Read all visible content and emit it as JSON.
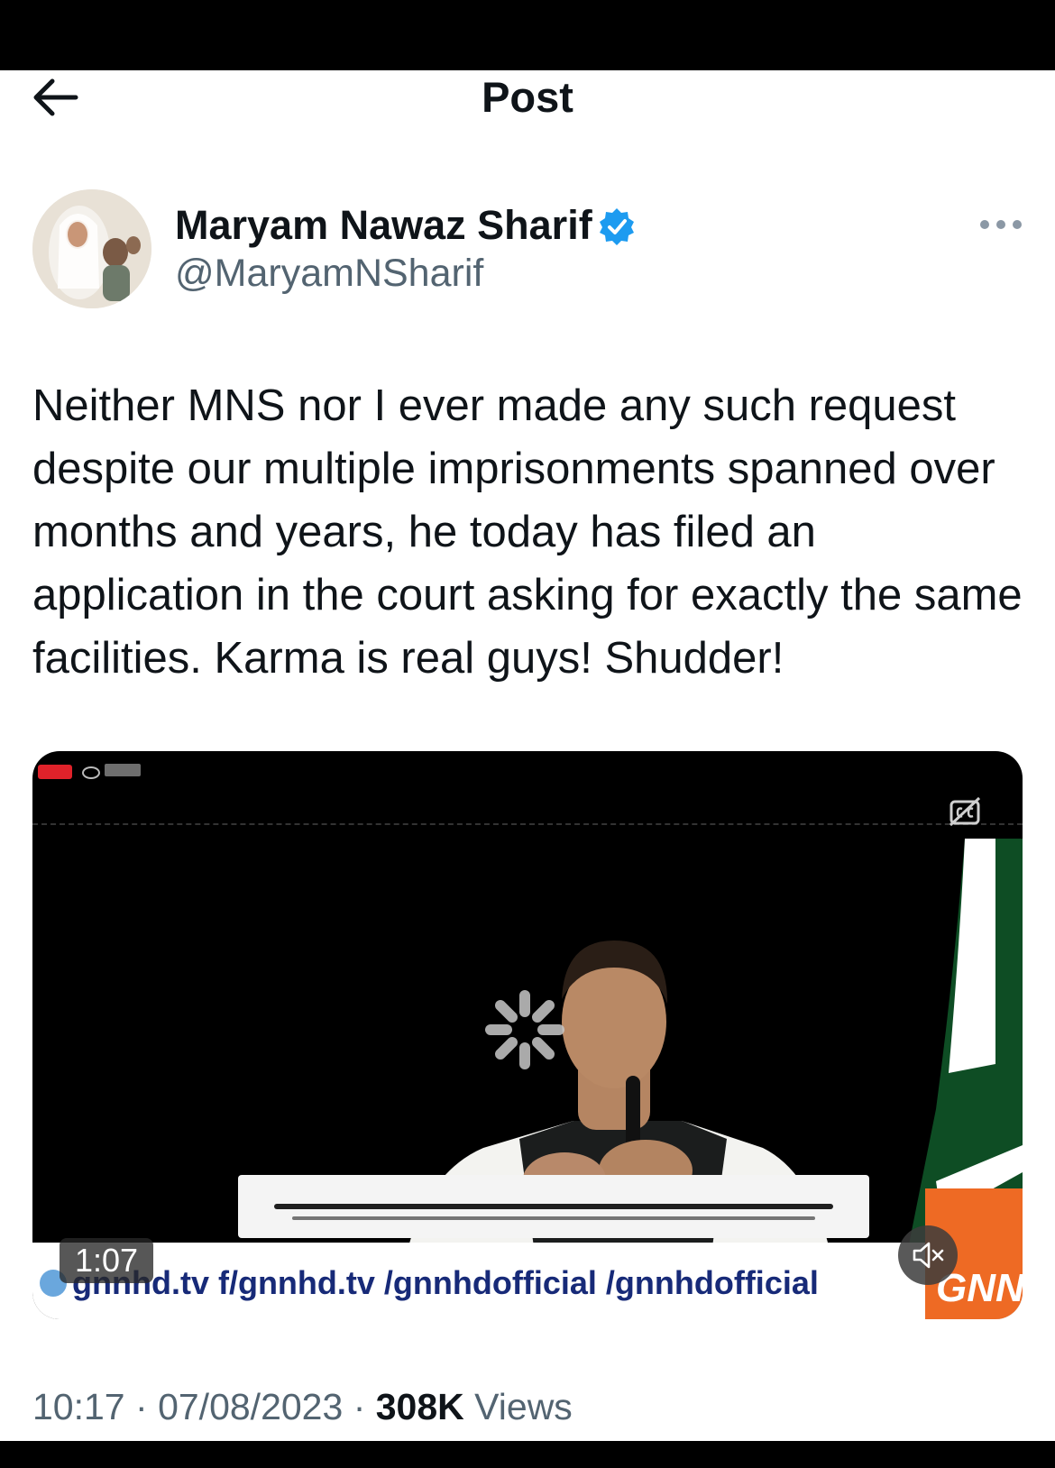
{
  "header": {
    "title": "Post",
    "back_icon": "arrow-left-icon"
  },
  "author": {
    "name": "Maryam Nawaz Sharif",
    "handle": "@MaryamNSharif",
    "verified": true,
    "verified_color": "#1d9bf0"
  },
  "post": {
    "text": "Neither MNS nor I ever made any such request despite our multiple imprisonments spanned over months and years, he today has filed an application in the court asking for exactly the same facilities. Karma is real guys! Shudder!"
  },
  "video": {
    "duration": "1:07",
    "ticker": "gnnhd.tv  f/gnnhd.tv  /gnnhdofficial  /gnnhdofficial",
    "logo": "GNN",
    "muted": true
  },
  "meta": {
    "time": "10:17",
    "date": "07/08/2023",
    "separator": "·",
    "views_count": "308K",
    "views_label": "Views"
  },
  "colors": {
    "text": "#0f1419",
    "secondary": "#536471",
    "accent": "#1d9bf0"
  }
}
